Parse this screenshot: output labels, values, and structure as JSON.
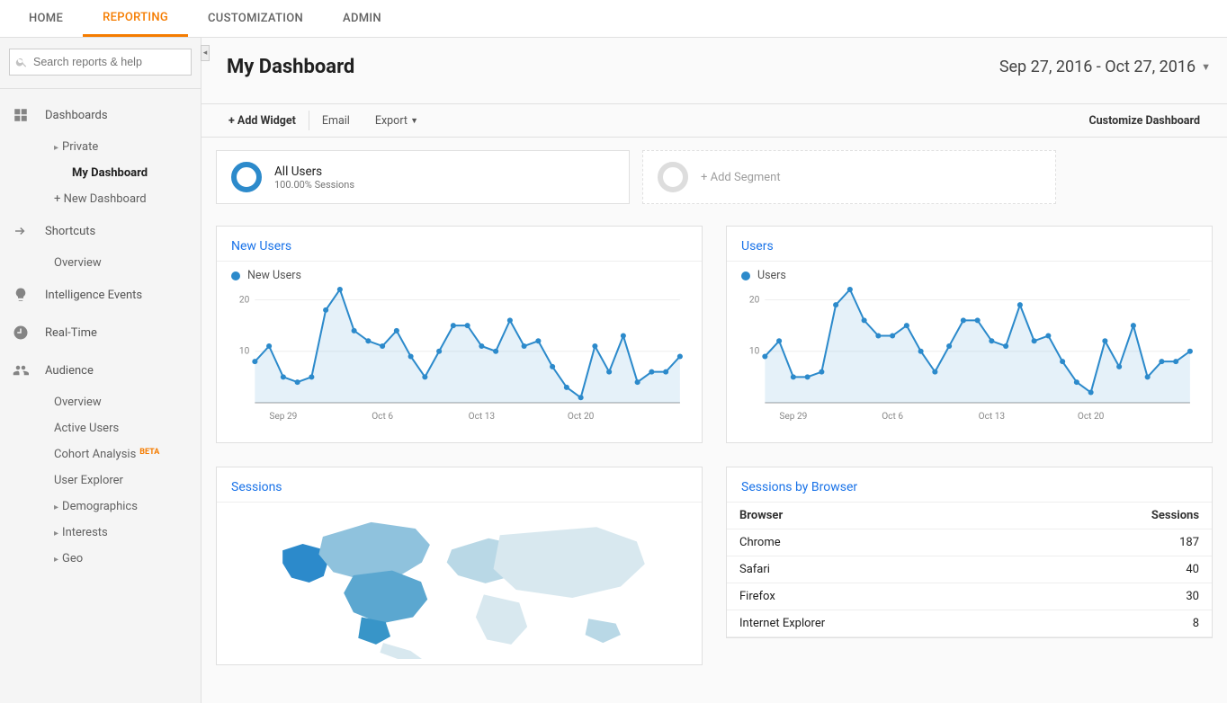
{
  "topnav": {
    "tabs": [
      "HOME",
      "REPORTING",
      "CUSTOMIZATION",
      "ADMIN"
    ],
    "active": 1
  },
  "search": {
    "placeholder": "Search reports & help"
  },
  "sidebar": {
    "items": [
      {
        "type": "section",
        "label": "Dashboards",
        "icon": "grid"
      },
      {
        "type": "child",
        "label": "Private",
        "caret": true
      },
      {
        "type": "child",
        "label": "My Dashboard",
        "active": true,
        "indent": true
      },
      {
        "type": "child",
        "label": "+ New Dashboard"
      },
      {
        "type": "section",
        "label": "Shortcuts",
        "icon": "shortcut"
      },
      {
        "type": "child",
        "label": "Overview"
      },
      {
        "type": "section",
        "label": "Intelligence Events",
        "icon": "bulb"
      },
      {
        "type": "section",
        "label": "Real-Time",
        "icon": "clock"
      },
      {
        "type": "section",
        "label": "Audience",
        "icon": "people"
      },
      {
        "type": "child",
        "label": "Overview"
      },
      {
        "type": "child",
        "label": "Active Users"
      },
      {
        "type": "child",
        "label": "Cohort Analysis",
        "beta": true
      },
      {
        "type": "child",
        "label": "User Explorer"
      },
      {
        "type": "child",
        "label": "Demographics",
        "caret": true
      },
      {
        "type": "child",
        "label": "Interests",
        "caret": true
      },
      {
        "type": "child",
        "label": "Geo",
        "caret": true
      }
    ]
  },
  "page": {
    "title": "My Dashboard",
    "dateRange": "Sep 27, 2016 - Oct 27, 2016"
  },
  "toolbar": {
    "addWidget": "+ Add Widget",
    "email": "Email",
    "export": "Export",
    "customize": "Customize Dashboard"
  },
  "segments": {
    "primary": {
      "title": "All Users",
      "sub": "100.00% Sessions"
    },
    "add": "+ Add Segment"
  },
  "widgets": {
    "newUsers": {
      "title": "New Users",
      "legend": "New Users"
    },
    "users": {
      "title": "Users",
      "legend": "Users"
    },
    "sessions": {
      "title": "Sessions"
    },
    "browser": {
      "title": "Sessions by Browser",
      "header1": "Browser",
      "header2": "Sessions",
      "rows": [
        [
          "Chrome",
          "187"
        ],
        [
          "Safari",
          "40"
        ],
        [
          "Firefox",
          "30"
        ],
        [
          "Internet Explorer",
          "8"
        ]
      ]
    }
  },
  "chart_data": [
    {
      "type": "line",
      "title": "New Users",
      "xlabel": "",
      "ylabel": "",
      "ylim": [
        0,
        22
      ],
      "x": [
        "Sep 27",
        "Sep 28",
        "Sep 29",
        "Sep 30",
        "Oct 1",
        "Oct 2",
        "Oct 3",
        "Oct 4",
        "Oct 5",
        "Oct 6",
        "Oct 7",
        "Oct 8",
        "Oct 9",
        "Oct 10",
        "Oct 11",
        "Oct 12",
        "Oct 13",
        "Oct 14",
        "Oct 15",
        "Oct 16",
        "Oct 17",
        "Oct 18",
        "Oct 19",
        "Oct 20",
        "Oct 21",
        "Oct 22",
        "Oct 23",
        "Oct 24",
        "Oct 25",
        "Oct 26",
        "Oct 27"
      ],
      "values": [
        8,
        11,
        5,
        4,
        5,
        18,
        22,
        14,
        12,
        11,
        14,
        9,
        5,
        10,
        15,
        15,
        11,
        10,
        16,
        11,
        12,
        7,
        3,
        1,
        11,
        6,
        13,
        4,
        6,
        6,
        9
      ],
      "xticks": [
        "Sep 29",
        "Oct 6",
        "Oct 13",
        "Oct 20"
      ],
      "yticks": [
        10,
        20
      ]
    },
    {
      "type": "line",
      "title": "Users",
      "xlabel": "",
      "ylabel": "",
      "ylim": [
        0,
        22
      ],
      "x": [
        "Sep 27",
        "Sep 28",
        "Sep 29",
        "Sep 30",
        "Oct 1",
        "Oct 2",
        "Oct 3",
        "Oct 4",
        "Oct 5",
        "Oct 6",
        "Oct 7",
        "Oct 8",
        "Oct 9",
        "Oct 10",
        "Oct 11",
        "Oct 12",
        "Oct 13",
        "Oct 14",
        "Oct 15",
        "Oct 16",
        "Oct 17",
        "Oct 18",
        "Oct 19",
        "Oct 20",
        "Oct 21",
        "Oct 22",
        "Oct 23",
        "Oct 24",
        "Oct 25",
        "Oct 26",
        "Oct 27"
      ],
      "values": [
        9,
        12,
        5,
        5,
        6,
        19,
        22,
        16,
        13,
        13,
        15,
        10,
        6,
        11,
        16,
        16,
        12,
        11,
        19,
        12,
        13,
        8,
        4,
        2,
        12,
        7,
        15,
        5,
        8,
        8,
        10
      ],
      "xticks": [
        "Sep 29",
        "Oct 6",
        "Oct 13",
        "Oct 20"
      ],
      "yticks": [
        10,
        20
      ]
    },
    {
      "type": "table",
      "title": "Sessions by Browser",
      "columns": [
        "Browser",
        "Sessions"
      ],
      "rows": [
        [
          "Chrome",
          187
        ],
        [
          "Safari",
          40
        ],
        [
          "Firefox",
          30
        ],
        [
          "Internet Explorer",
          8
        ]
      ]
    }
  ]
}
